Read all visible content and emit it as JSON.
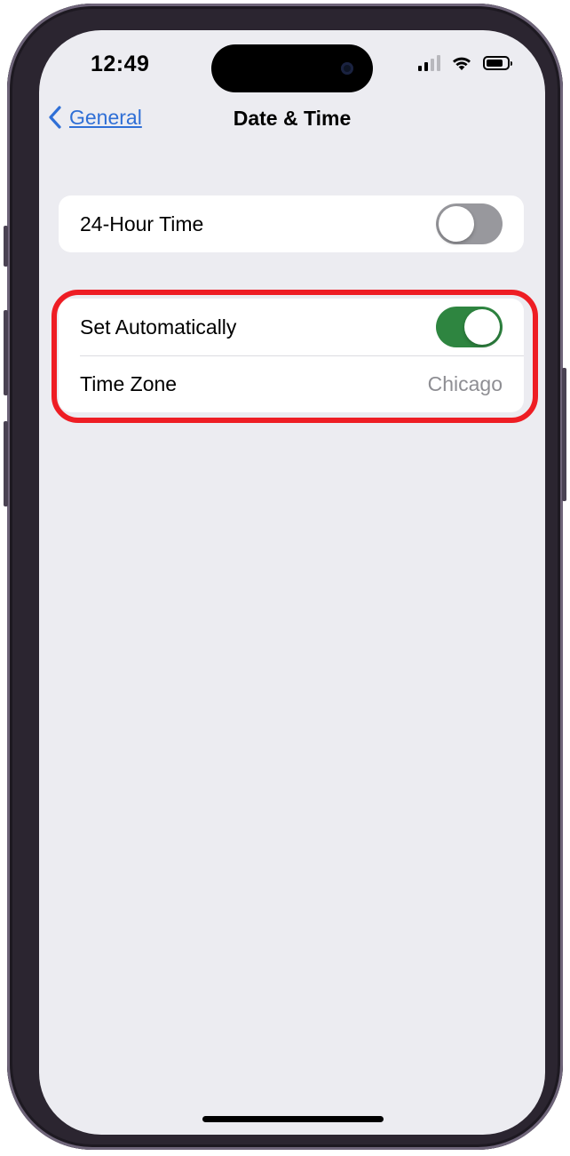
{
  "status_bar": {
    "time": "12:49",
    "icons": [
      "cellular-signal-icon",
      "wifi-icon",
      "battery-icon"
    ]
  },
  "nav": {
    "back_label": "General",
    "back_icon": "chevron-left-icon",
    "title": "Date & Time"
  },
  "group1": {
    "rows": [
      {
        "label": "24-Hour Time",
        "control": "toggle",
        "state": "off"
      }
    ]
  },
  "group2": {
    "rows": [
      {
        "label": "Set Automatically",
        "control": "toggle",
        "state": "on"
      },
      {
        "label": "Time Zone",
        "value": "Chicago"
      }
    ]
  },
  "colors": {
    "accent": "#2f6fd6",
    "toggle_on": "#2e8540",
    "toggle_off": "#98989d",
    "highlight": "#ee1d24",
    "background": "#ececf1"
  }
}
